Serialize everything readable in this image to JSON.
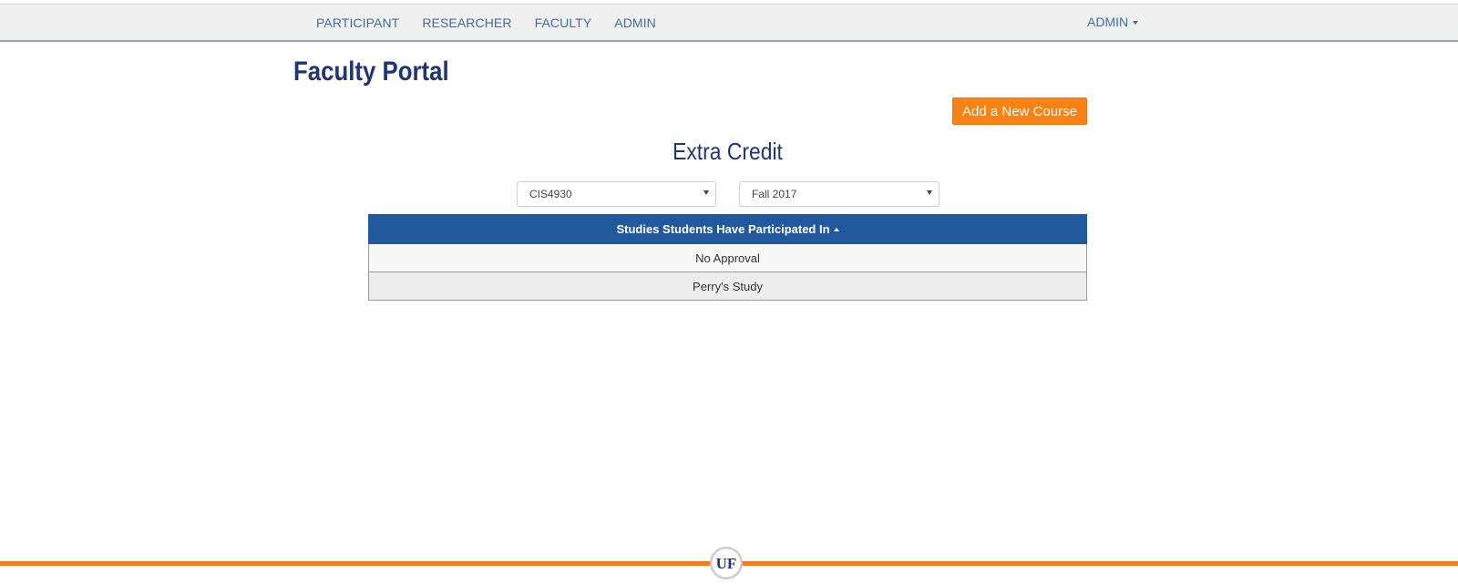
{
  "nav": {
    "items": [
      {
        "label": "PARTICIPANT"
      },
      {
        "label": "RESEARCHER"
      },
      {
        "label": "FACULTY"
      },
      {
        "label": "ADMIN"
      }
    ],
    "user_menu": {
      "label": "ADMIN",
      "icon": "caret-down-icon"
    }
  },
  "page": {
    "title": "Faculty Portal",
    "add_course_label": "Add a New Course",
    "section_title": "Extra Credit"
  },
  "filters": {
    "course": {
      "selected": "CIS4930"
    },
    "term": {
      "selected": "Fall 2017"
    }
  },
  "table": {
    "header": "Studies Students Have Participated In",
    "sort_icon": "sort-ascending-icon",
    "rows": [
      {
        "study": "No Approval"
      },
      {
        "study": "Perry's Study"
      }
    ]
  },
  "footer": {
    "logo_text": "UF",
    "accent_color": "#f57a1f",
    "brand_color": "#1f3576"
  }
}
